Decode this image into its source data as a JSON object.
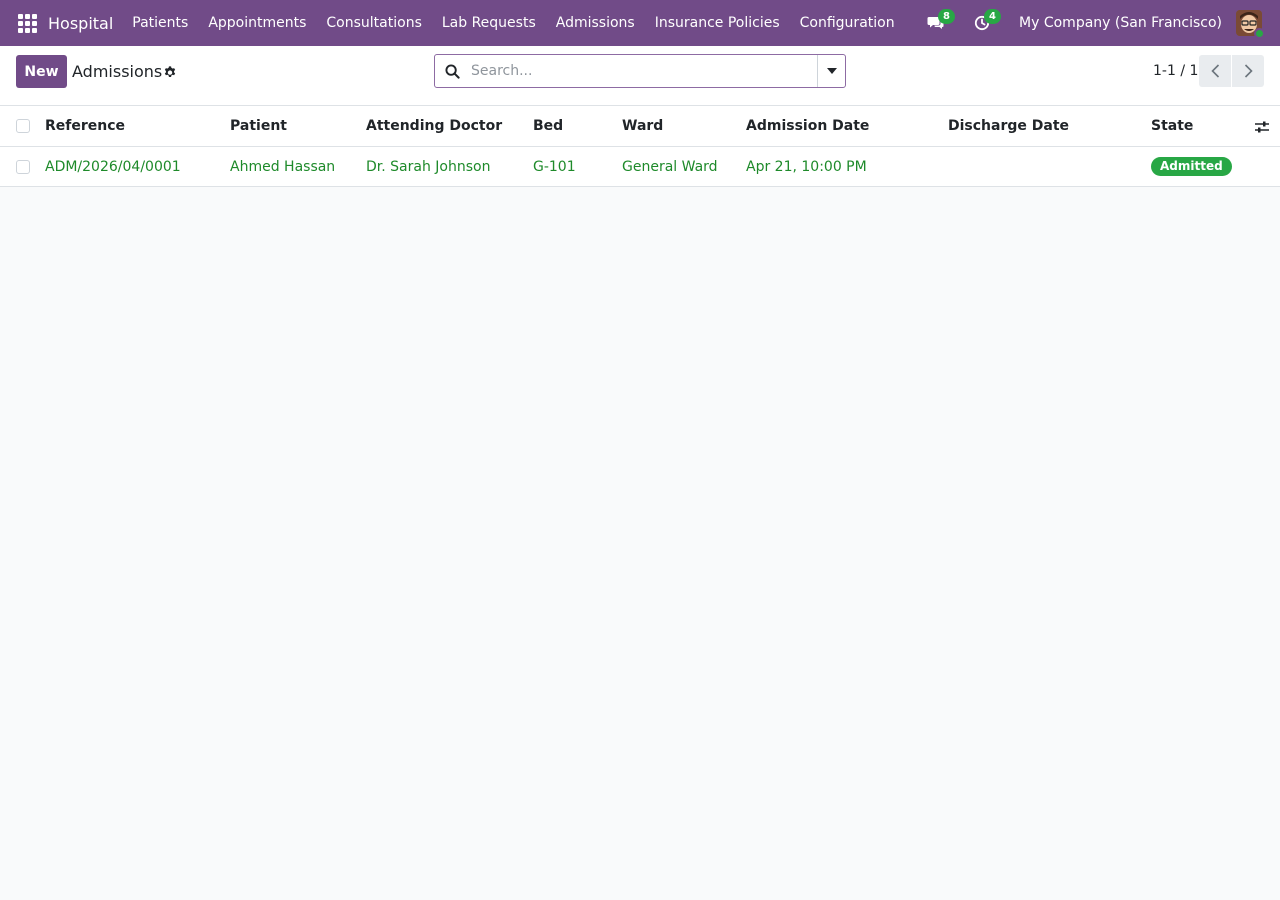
{
  "navbar": {
    "brand": "Hospital",
    "menu": [
      "Patients",
      "Appointments",
      "Consultations",
      "Lab Requests",
      "Admissions",
      "Insurance Policies",
      "Configuration"
    ],
    "messages_count": "8",
    "activities_count": "4",
    "company": "My Company (San Francisco)"
  },
  "control": {
    "new_label": "New",
    "title": "Admissions",
    "search_placeholder": "Search...",
    "pager": "1-1 / 1"
  },
  "table": {
    "headers": [
      "Reference",
      "Patient",
      "Attending Doctor",
      "Bed",
      "Ward",
      "Admission Date",
      "Discharge Date",
      "State"
    ],
    "rows": [
      {
        "reference": "ADM/2026/04/0001",
        "patient": "Ahmed Hassan",
        "doctor": "Dr. Sarah Johnson",
        "bed": "G-101",
        "ward": "General Ward",
        "admission_date": "Apr 21, 10:00 PM",
        "discharge_date": "",
        "state": "Admitted"
      }
    ]
  },
  "colors": {
    "brand": "#714b88",
    "link": "#1e8a2a",
    "success": "#28a745"
  },
  "icons": [
    "apps-grid-icon",
    "chat-icon",
    "clock-icon",
    "gear-icon",
    "search-icon",
    "caret-down-icon",
    "chevron-left-icon",
    "chevron-right-icon",
    "column-options-icon"
  ]
}
